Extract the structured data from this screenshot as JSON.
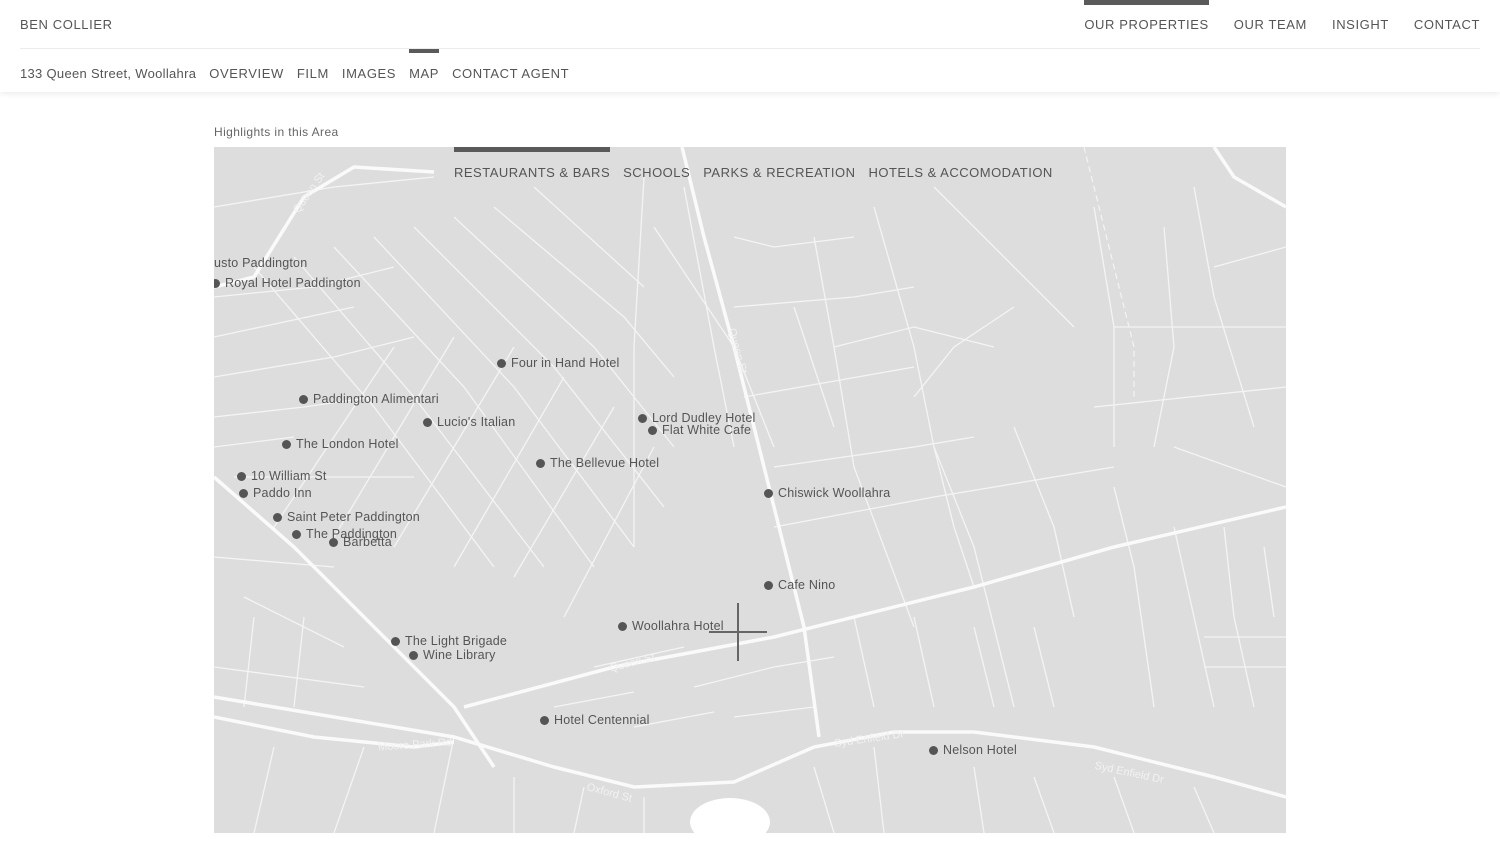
{
  "header": {
    "brand": "BEN COLLIER",
    "nav": [
      {
        "label": "OUR PROPERTIES",
        "active": true
      },
      {
        "label": "OUR TEAM",
        "active": false
      },
      {
        "label": "INSIGHT",
        "active": false
      },
      {
        "label": "CONTACT",
        "active": false
      }
    ]
  },
  "subnav": {
    "address": "133 Queen Street, Woollahra",
    "items": [
      {
        "label": "OVERVIEW",
        "active": false
      },
      {
        "label": "FILM",
        "active": false
      },
      {
        "label": "IMAGES",
        "active": false
      },
      {
        "label": "MAP",
        "active": true
      },
      {
        "label": "CONTACT AGENT",
        "active": false
      }
    ]
  },
  "section": {
    "heading": "Highlights in this Area"
  },
  "map": {
    "tabs": [
      {
        "label": "RESTAURANTS & BARS",
        "active": true
      },
      {
        "label": "SCHOOLS",
        "active": false
      },
      {
        "label": "PARKS & RECREATION",
        "active": false
      },
      {
        "label": "HOTELS & ACCOMODATION",
        "active": false
      }
    ],
    "pois": [
      {
        "label": "usto Paddington",
        "dot": false
      },
      {
        "label": "Royal Hotel Paddington",
        "dot": true
      },
      {
        "label": "Four in Hand Hotel",
        "dot": true
      },
      {
        "label": "Paddington Alimentari",
        "dot": true
      },
      {
        "label": "Lucio's Italian",
        "dot": true
      },
      {
        "label": "Lord Dudley Hotel",
        "dot": true
      },
      {
        "label": "Flat White Cafe",
        "dot": true
      },
      {
        "label": "The London Hotel",
        "dot": true
      },
      {
        "label": "The Bellevue Hotel",
        "dot": true
      },
      {
        "label": "10 William St",
        "dot": true
      },
      {
        "label": "Paddo Inn",
        "dot": true
      },
      {
        "label": "Chiswick Woollahra",
        "dot": true
      },
      {
        "label": "Saint Peter Paddington",
        "dot": true
      },
      {
        "label": "The Paddington",
        "dot": true
      },
      {
        "label": "Barbetta",
        "dot": true
      },
      {
        "label": "Cafe Nino",
        "dot": true
      },
      {
        "label": "Woollahra Hotel",
        "dot": true
      },
      {
        "label": "The Light Brigade",
        "dot": true
      },
      {
        "label": "Wine Library",
        "dot": true
      },
      {
        "label": "Hotel Centennial",
        "dot": true
      },
      {
        "label": "Nelson Hotel",
        "dot": true
      }
    ],
    "streets": [
      "Queen St",
      "Queen St",
      "Queen St",
      "Oxford St",
      "Syd Enfield Dr",
      "Syd Enfield Dr",
      "Moore Park Rd"
    ]
  }
}
